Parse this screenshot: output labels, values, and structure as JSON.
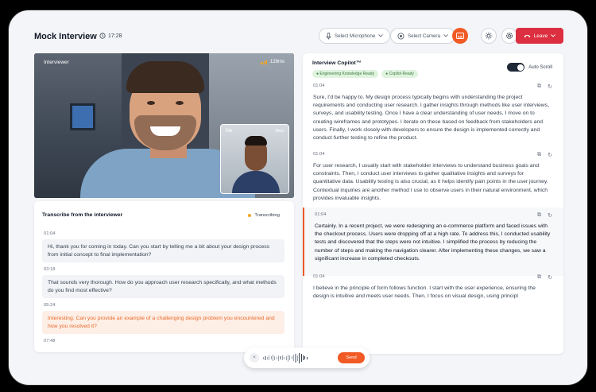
{
  "header": {
    "title": "Mock Interview",
    "timer": "17:28",
    "microphone_label": "Select Microphone",
    "camera_label": "Select Camera",
    "leave_label": "Leave"
  },
  "video": {
    "main_label": "Interviewer",
    "main_latency": "128ms",
    "pip_label": "Me",
    "pip_latency": "8ms"
  },
  "transcript": {
    "title": "Transcribe from the interviewer",
    "status": "Transcribing",
    "messages": [
      {
        "time": "01:04",
        "text": "Hi, thank you for coming in today. Can you start by telling me a bit about your design process from initial concept to final implementation?"
      },
      {
        "time": "03:18",
        "text": "That sounds very thorough. How do you approach user research specifically, and what methods do you find most effective?"
      },
      {
        "time": "05:24",
        "text": "Interesting. Can you provide an example of a challenging design problem you encountered and how you resolved it?"
      },
      {
        "time": "07:48",
        "text": ""
      }
    ]
  },
  "copilot": {
    "title": "Interview Copilot™",
    "tags": [
      "Engineering Knowledge Ready",
      "Copilot Ready"
    ],
    "autoscroll_label": "Auto Scroll",
    "entries": [
      {
        "time": "01:04",
        "text": "Sure, I'd be happy to. My design process typically begins with understanding the project requirements and conducting user research. I gather insights through methods like user interviews, surveys, and usability testing. Once I have a clear understanding of user needs, I move on to creating wireframes and prototypes. I iterate on these based on feedback from stakeholders and users. Finally, I work closely with developers to ensure the design is implemented correctly and conduct further testing to refine the product."
      },
      {
        "time": "01:04",
        "text": "For user research, I usually start with stakeholder interviews to understand business goals and constraints. Then, I conduct user interviews to gather qualitative insights and surveys for quantitative data. Usability testing is also crucial, as it helps identify pain points in the user journey. Contextual inquiries are another method I use to observe users in their natural environment, which provides invaluable insights."
      },
      {
        "time": "01:04",
        "text": "Certainly. In a recent project, we were redesigning an e-commerce platform and faced issues with the checkout process. Users were dropping off at a high rate. To address this, I conducted usability tests and discovered that the steps were not intuitive. I simplified the process by reducing the number of steps and making the navigation clearer. After implementing these changes, we saw a significant increase in completed checkouts."
      },
      {
        "time": "01:04",
        "text": "I believe in the principle of form follows function. I start with the user experience, ensuring the design is intuitive and meets user needs. Then, I focus on visual design, using principl"
      }
    ]
  },
  "sendbar": {
    "close_glyph": "×",
    "send_label": "Send"
  },
  "colors": {
    "accent": "#f15a24",
    "leave": "#dc2f40",
    "highlight_text": "#ea6a2a"
  }
}
